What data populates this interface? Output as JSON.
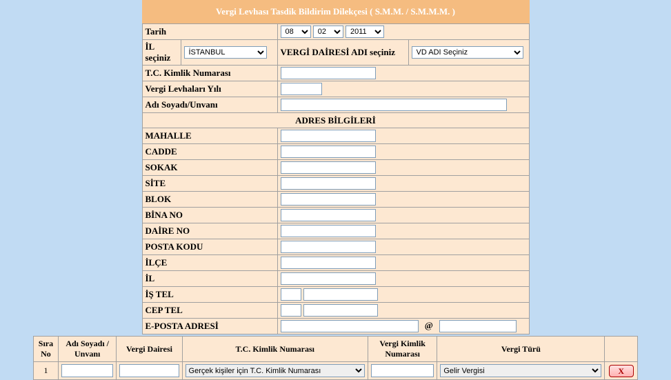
{
  "header": {
    "title": "Vergi Levhası Tasdik Bildirim Dilekçesi ( S.M.M. / S.M.M.M. )"
  },
  "labels": {
    "tarih": "Tarih",
    "il_seciniz": "İL seçiniz",
    "vd_adi_seciniz": "VERGİ DAİRESİ ADI seçiniz",
    "tc_kimlik": "T.C. Kimlik Numarası",
    "vergi_levhalari_yili": "Vergi Levhaları Yılı",
    "adi_soyadi_unvani": "Adı Soyadı/Unvanı",
    "adres_bilgileri": "ADRES BİLGİLERİ",
    "mahalle": "MAHALLE",
    "cadde": "CADDE",
    "sokak": "SOKAK",
    "site": "SİTE",
    "blok": "BLOK",
    "bina_no": "BİNA NO",
    "daire_no": "DAİRE NO",
    "posta_kodu": "POSTA KODU",
    "ilce": "İLÇE",
    "il": "İL",
    "is_tel": "İŞ TEL",
    "cep_tel": "CEP TEL",
    "eposta": "E-POSTA ADRESİ",
    "at": "@"
  },
  "values": {
    "date_day": "08",
    "date_month": "02",
    "date_year": "2011",
    "il_selected": "İSTANBUL",
    "vd_selected": "VD ADI Seçiniz"
  },
  "bottom": {
    "headers": {
      "sira_no": "Sıra No",
      "adi_soyadi": "Adı Soyadı / Unvanı",
      "vergi_dairesi": "Vergi Dairesi",
      "tc_kimlik": "T.C. Kimlik Numarası",
      "vergi_kimlik": "Vergi Kimlik Numarası",
      "vergi_turu": "Vergi Türü"
    },
    "row1": {
      "sira": "1",
      "tc_kimlik_sel": "Gerçek kişiler için T.C. Kimlik Numarası",
      "vergi_turu_sel": "Gelir Vergisi",
      "delete_label": "X"
    }
  }
}
